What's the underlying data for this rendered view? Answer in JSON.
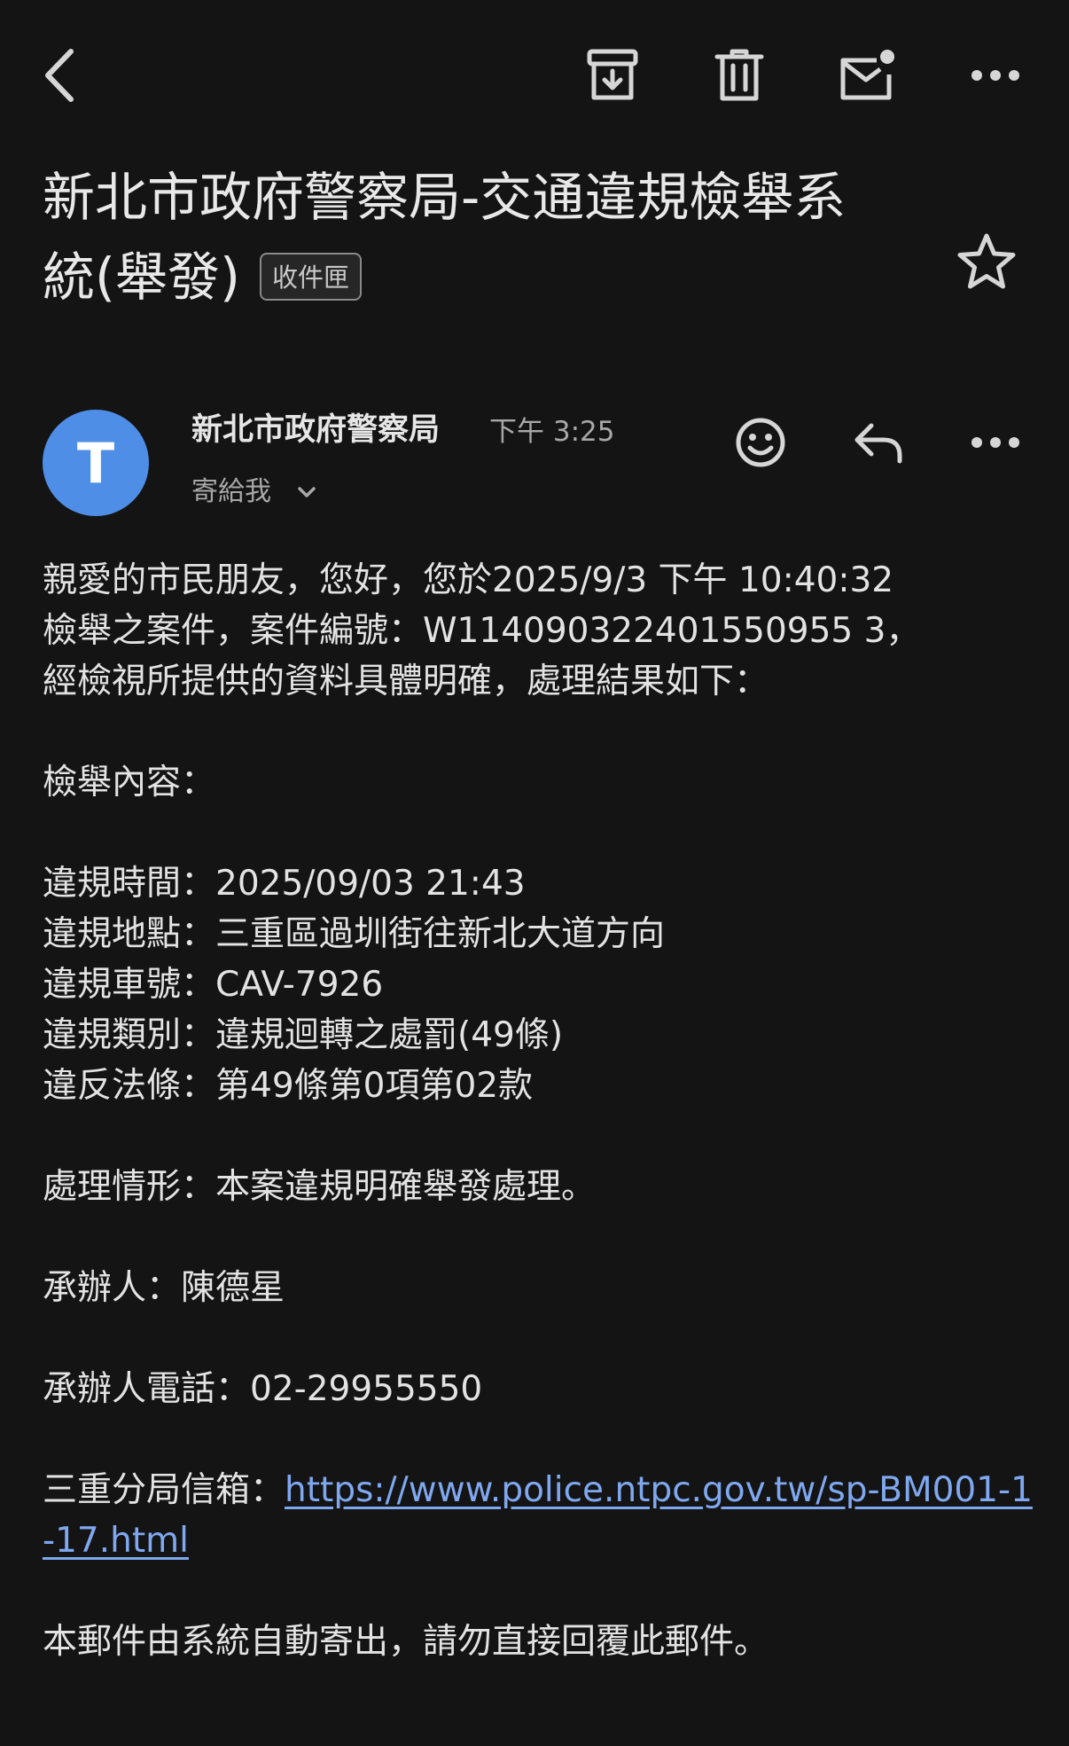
{
  "toolbar": {
    "back_icon": "arrow-back-icon",
    "archive_icon": "archive-icon",
    "delete_icon": "trash-icon",
    "unread_icon": "mark-unread-icon",
    "more_icon": "more-horizontal-icon"
  },
  "subject": {
    "title": "新北市政府警察局-交通違規檢舉系統(舉發)",
    "label": "收件匣"
  },
  "sender": {
    "avatar_letter": "T",
    "avatar_color": "#4f8ee6",
    "name": "新北市政府警察局",
    "time": "下午 3:25",
    "recipient": "寄給我"
  },
  "body": {
    "intro": [
      "親愛的市民朋友，您好，您於2025/9/3 下午 10:40:32",
      "檢舉之案件，案件編號：W114090322401550955 3，",
      "經檢視所提供的資料具體明確，處理結果如下："
    ],
    "content_heading": "檢舉內容：",
    "details": [
      "違規時間：2025/09/03 21:43",
      "違規地點：三重區過圳街往新北大道方向",
      "違規車號：CAV-7926",
      "違規類別：違規迴轉之處罰(49條)",
      "違反法條：第49條第0項第02款"
    ],
    "result": "處理情形：本案違規明確舉發處理。",
    "officer": "承辦人：陳德星",
    "phone": "承辦人電話：02-29955550",
    "mailbox_label": "三重分局信箱：",
    "mailbox_link": "https://www.police.ntpc.gov.tw/sp-BM001-1-17.html",
    "footer": "本郵件由系統自動寄出，請勿直接回覆此郵件。"
  },
  "colors": {
    "background": "#141414",
    "link": "#7fa8f0"
  }
}
